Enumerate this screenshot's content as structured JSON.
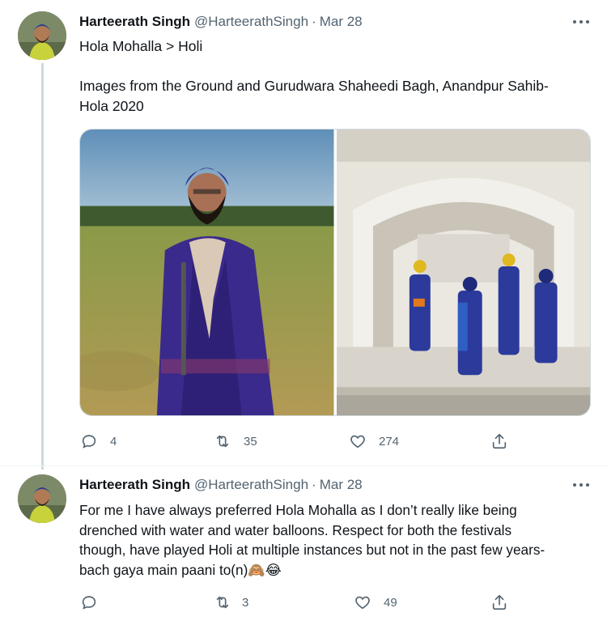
{
  "tweets": [
    {
      "name": "Harteerath Singh",
      "handle": "@HarteerathSingh",
      "separator": "·",
      "date": "Mar 28",
      "text_lines": [
        "Hola Mohalla > Holi",
        "",
        "Images from the Ground and Gurudwara Shaheedi Bagh, Anandpur Sahib-",
        "Hola 2020"
      ],
      "reply_count": "4",
      "retweet_count": "35",
      "like_count": "274"
    },
    {
      "name": "Harteerath Singh",
      "handle": "@HarteerathSingh",
      "separator": "·",
      "date": "Mar 28",
      "text_lines": [
        "For me I have always preferred Hola Mohalla as I don’t really like being",
        "drenched with water and water balloons. Respect for both the festivals",
        "though, have played Holi at multiple instances but not in the past few years-",
        "bach gaya main paani to(n)🙈😂"
      ],
      "reply_count": "",
      "retweet_count": "3",
      "like_count": "49"
    }
  ],
  "icons": {
    "reply": "reply-icon",
    "retweet": "retweet-icon",
    "like": "heart-icon",
    "share": "share-icon",
    "more": "more-icon"
  },
  "colors": {
    "secondary_text": "#536471",
    "thread_line": "#cfd9de",
    "primary_text": "#0f1419"
  }
}
